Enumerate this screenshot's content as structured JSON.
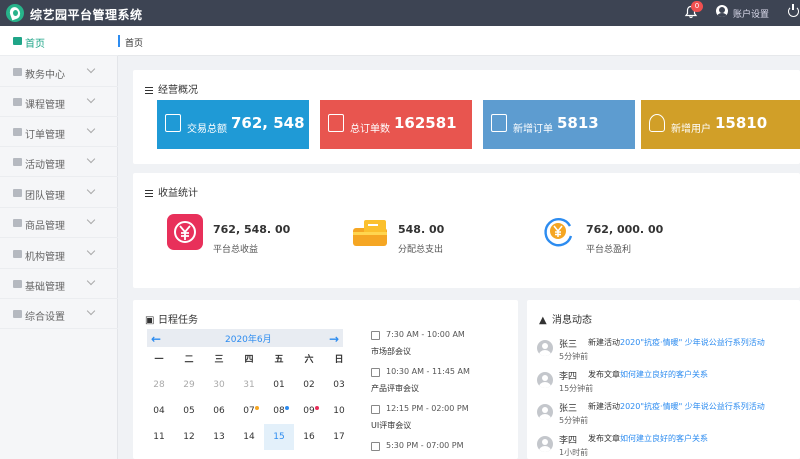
{
  "app": {
    "title": "综艺园平台管理系统"
  },
  "header": {
    "notification_count": "0",
    "account_label": "账户设置"
  },
  "sidebar": {
    "items": [
      {
        "label": "首页",
        "icon": "home-icon",
        "active": true
      },
      {
        "label": "教务中心",
        "icon": "keyboard-icon"
      },
      {
        "label": "课程管理",
        "icon": "book-icon"
      },
      {
        "label": "订单管理",
        "icon": "file-icon"
      },
      {
        "label": "活动管理",
        "icon": "gift-icon"
      },
      {
        "label": "团队管理",
        "icon": "team-icon"
      },
      {
        "label": "商品管理",
        "icon": "cart-icon"
      },
      {
        "label": "机构管理",
        "icon": "graduation-cap-icon"
      },
      {
        "label": "基础管理",
        "icon": "keyboard-icon"
      },
      {
        "label": "综合设置",
        "icon": "gear-icon"
      }
    ]
  },
  "breadcrumb": {
    "current": "首页"
  },
  "overview": {
    "title": "经营概况",
    "cards": [
      {
        "label": "交易总额",
        "value": "762, 548",
        "color": "#1f9ad6",
        "icon": "wallet-icon"
      },
      {
        "label": "总订单数",
        "value": "162581",
        "color": "#e8554f",
        "icon": "clipboard-icon"
      },
      {
        "label": "新增订单",
        "value": "5813",
        "color": "#5d9cd0",
        "icon": "checklist-icon"
      },
      {
        "label": "新增用户",
        "value": "15810",
        "color": "#d19f28",
        "icon": "user-icon"
      }
    ]
  },
  "earnings": {
    "title": "收益统计",
    "items": [
      {
        "value": "762, 548. 00",
        "label": "平台总收益",
        "icon": "yen-exchange-icon"
      },
      {
        "value": "548. 00",
        "label": "分配总支出",
        "icon": "cash-icon"
      },
      {
        "value": "762, 000. 00",
        "label": "平台总盈利",
        "icon": "yen-cycle-icon"
      }
    ]
  },
  "schedule": {
    "title": "日程任务",
    "month": "2020年6月",
    "weekdays": [
      "一",
      "二",
      "三",
      "四",
      "五",
      "六",
      "日"
    ],
    "weeks": [
      [
        "28",
        "29",
        "30",
        "31",
        "01",
        "02",
        "03"
      ],
      [
        "04",
        "05",
        "06",
        "07",
        "08",
        "09",
        "10"
      ],
      [
        "11",
        "12",
        "13",
        "14",
        "15",
        "16",
        "17"
      ]
    ],
    "today": "15",
    "events": [
      {
        "time": "7:30 AM - 10:00 AM",
        "title": "市场部会议"
      },
      {
        "time": "10:30 AM - 11:45 AM",
        "title": "产品评审会议"
      },
      {
        "time": "12:15 PM - 02:00 PM",
        "title": "UI评审会议"
      },
      {
        "time": "5:30 PM - 07:00 PM",
        "title": ""
      }
    ]
  },
  "messages": {
    "title": "消息动态",
    "items": [
      {
        "name": "张三",
        "time": "5分钟前",
        "action": "新建活动",
        "link": "2020\"抗疫·情暖\" 少年说公益行系列活动"
      },
      {
        "name": "李四",
        "time": "15分钟前",
        "action": "发布文章",
        "link": "如何建立良好的客户关系"
      },
      {
        "name": "张三",
        "time": "5分钟前",
        "action": "新建活动",
        "link": "2020\"抗疫·情暖\" 少年说公益行系列活动"
      },
      {
        "name": "李四",
        "time": "1小时前",
        "action": "发布文章",
        "link": "如何建立良好的客户关系"
      }
    ]
  },
  "colors": {
    "topbar": "#3d4453",
    "accent": "#1fa588",
    "link": "#2d8cf0"
  }
}
